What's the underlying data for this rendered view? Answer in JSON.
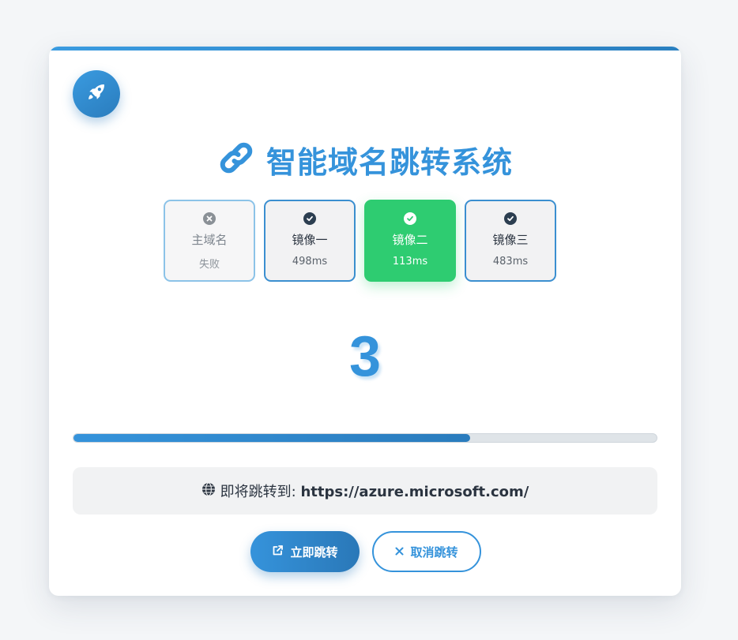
{
  "app": {
    "title": "智能域名跳转系统"
  },
  "mirrors": [
    {
      "name": "主域名",
      "detail": "失败",
      "status": "failed",
      "icon": "x-circle-icon"
    },
    {
      "name": "镜像一",
      "detail": "498ms",
      "status": "ok",
      "icon": "check-circle-icon"
    },
    {
      "name": "镜像二",
      "detail": "113ms",
      "status": "selected",
      "icon": "check-circle-icon"
    },
    {
      "name": "镜像三",
      "detail": "483ms",
      "status": "ok",
      "icon": "check-circle-icon"
    }
  ],
  "countdown": {
    "value": "3",
    "progress_fraction": 0.68
  },
  "redirect": {
    "label": "即将跳转到: ",
    "url": "https://azure.microsoft.com/"
  },
  "buttons": {
    "go_label": "立即跳转",
    "cancel_label": "取消跳转"
  },
  "colors": {
    "accent": "#3593db",
    "success": "#2ecc71",
    "failed_border": "#8cc3e8"
  },
  "icons": {
    "logo": "rocket-icon",
    "title": "link-icon",
    "redirect": "globe-icon",
    "go": "external-link-icon",
    "cancel": "close-icon"
  }
}
